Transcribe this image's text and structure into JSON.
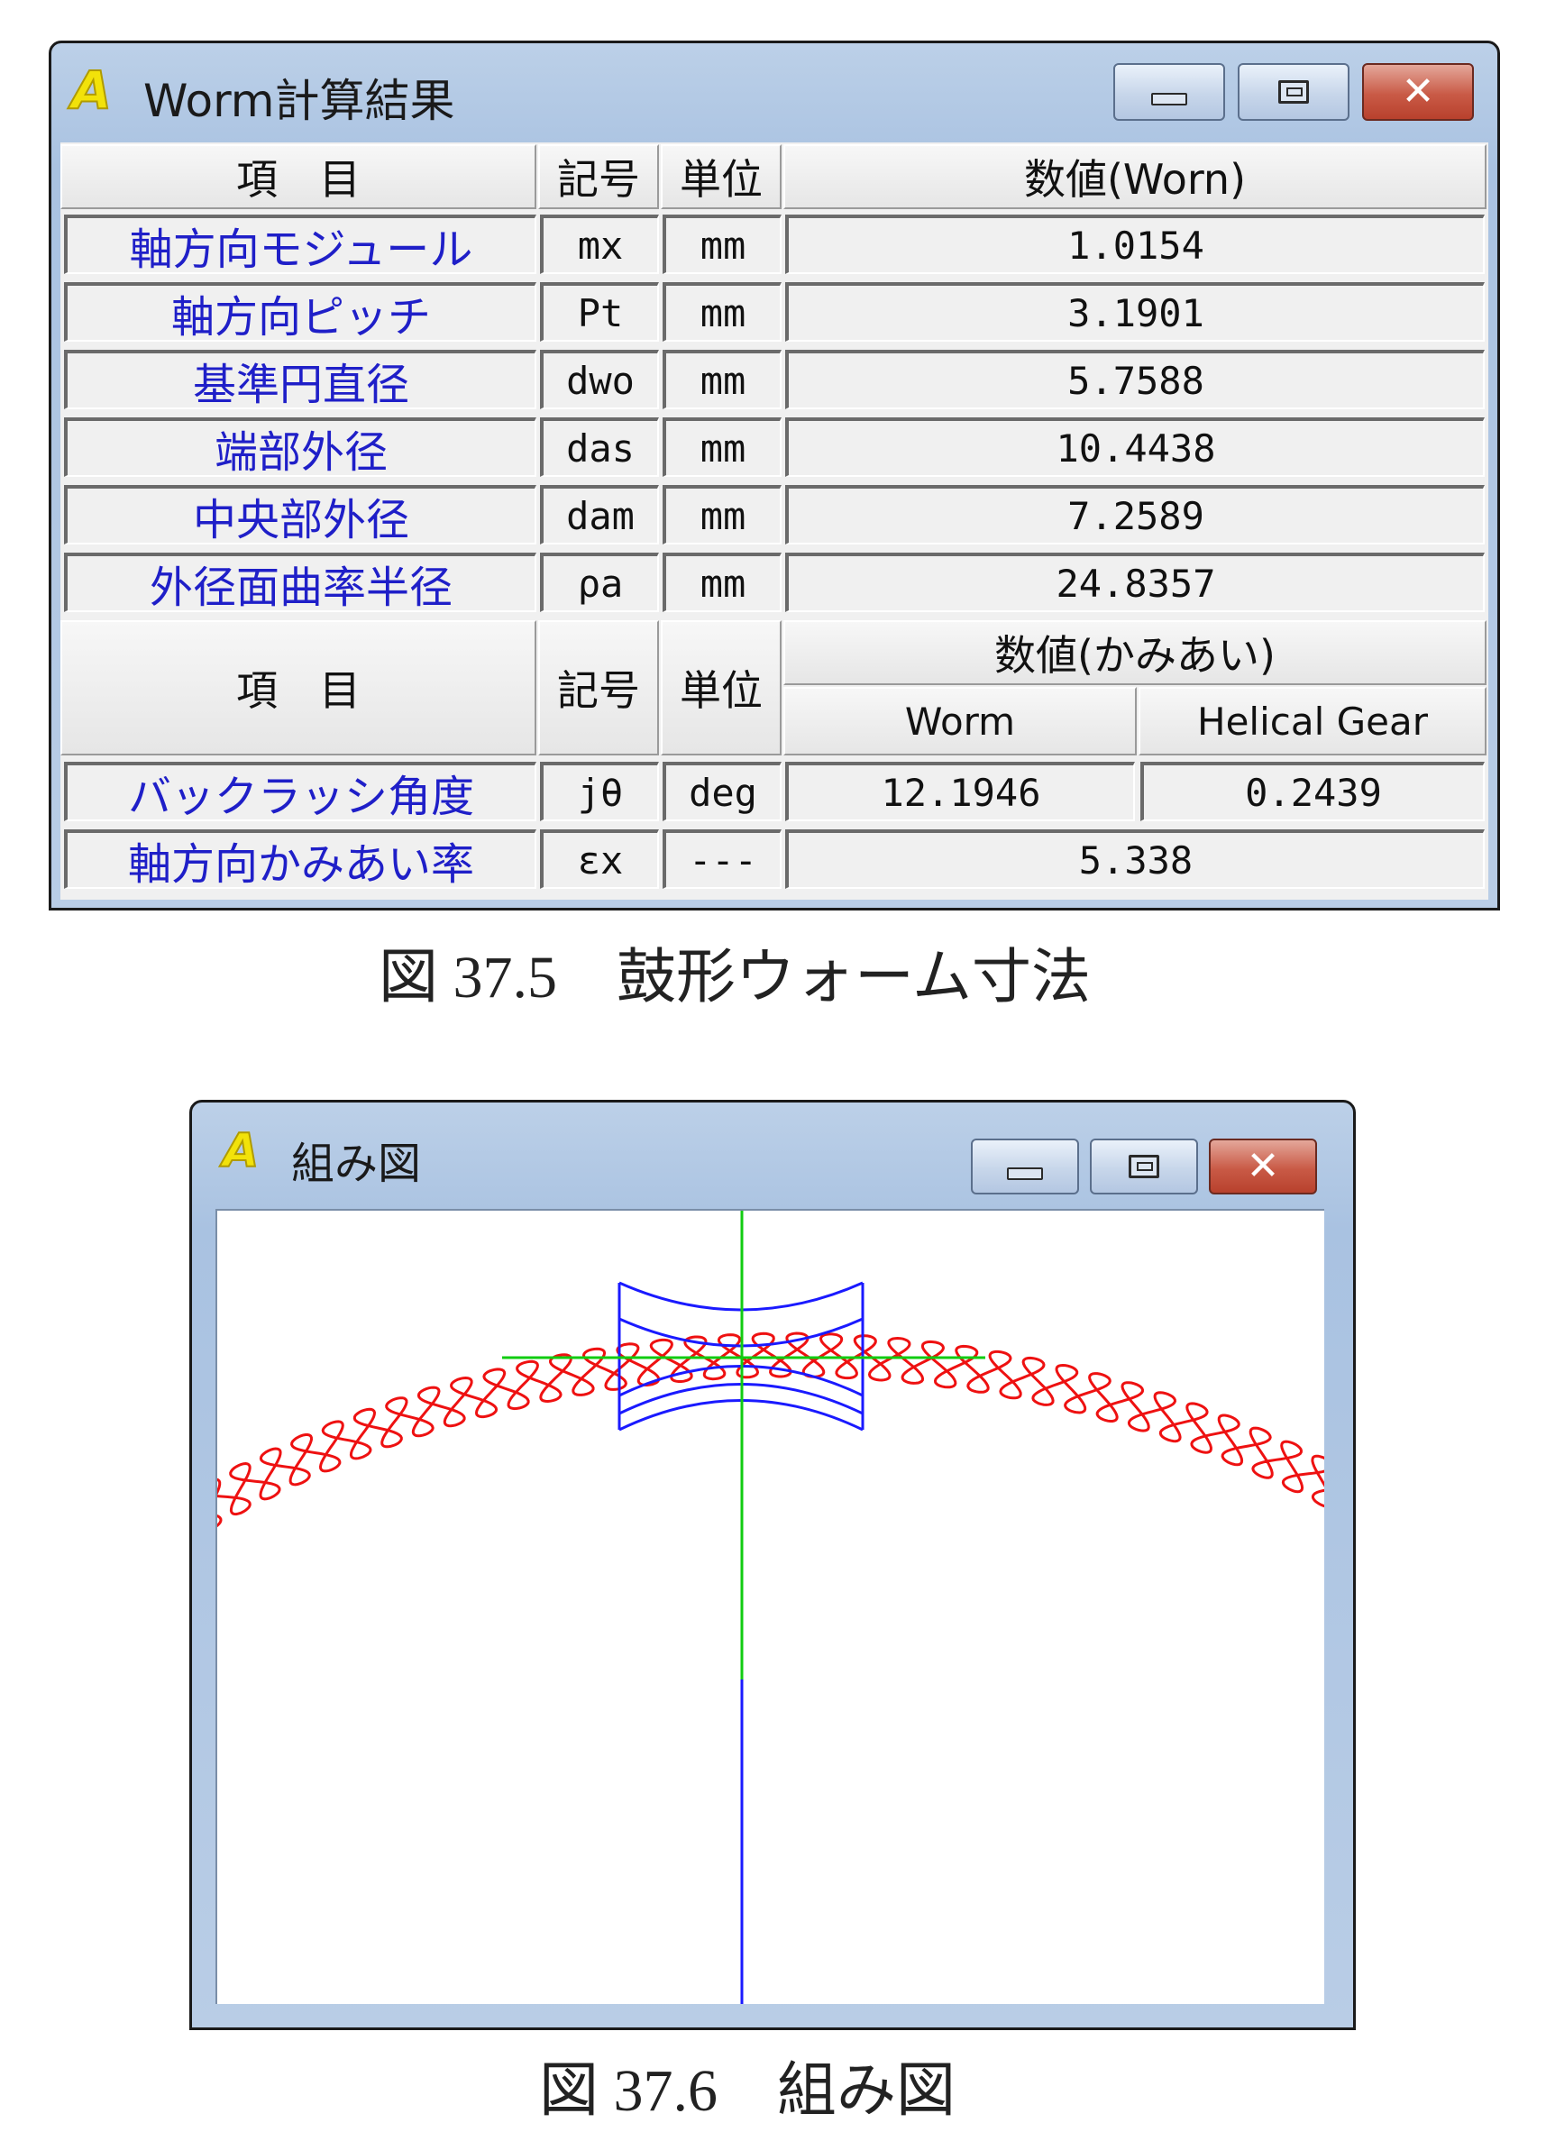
{
  "result_window": {
    "title": "Worm計算結果",
    "app_icon": "A",
    "buttons": {
      "minimize": "minimize-icon",
      "maximize": "restore-icon",
      "close": "close-icon"
    },
    "header": {
      "item": "項　目",
      "symbol": "記号",
      "unit": "単位",
      "value": "数値(Worn)"
    },
    "rows": [
      {
        "label": "軸方向モジュール",
        "symbol": "mx",
        "unit": "mm",
        "value": "1.0154"
      },
      {
        "label": "軸方向ピッチ",
        "symbol": "Pt",
        "unit": "mm",
        "value": "3.1901"
      },
      {
        "label": "基準円直径",
        "symbol": "dwo",
        "unit": "mm",
        "value": "5.7588"
      },
      {
        "label": "端部外径",
        "symbol": "das",
        "unit": "mm",
        "value": "10.4438"
      },
      {
        "label": "中央部外径",
        "symbol": "dam",
        "unit": "mm",
        "value": "7.2589"
      },
      {
        "label": "外径面曲率半径",
        "symbol": "ρa",
        "unit": "mm",
        "value": "24.8357"
      }
    ],
    "header2": {
      "item": "項　目",
      "symbol": "記号",
      "unit": "単位",
      "value": "数値(かみあい)",
      "worm": "Worm",
      "gear": "Helical Gear"
    },
    "rows2": [
      {
        "label": "バックラッシ角度",
        "symbol": "jθ",
        "unit": "deg",
        "worm": "12.1946",
        "gear": "0.2439"
      },
      {
        "label": "軸方向かみあい率",
        "symbol": "εx",
        "unit": "---",
        "value": "5.338"
      }
    ]
  },
  "caption1": "図 37.5　鼓形ウォーム寸法",
  "assembly_window": {
    "title": "組み図",
    "app_icon": "A",
    "colors": {
      "worm": "#1a1aff",
      "gear": "#ee1111",
      "axis": "#11cc11",
      "background": "#ffffff"
    }
  },
  "caption2": "図 37.6　組み図"
}
